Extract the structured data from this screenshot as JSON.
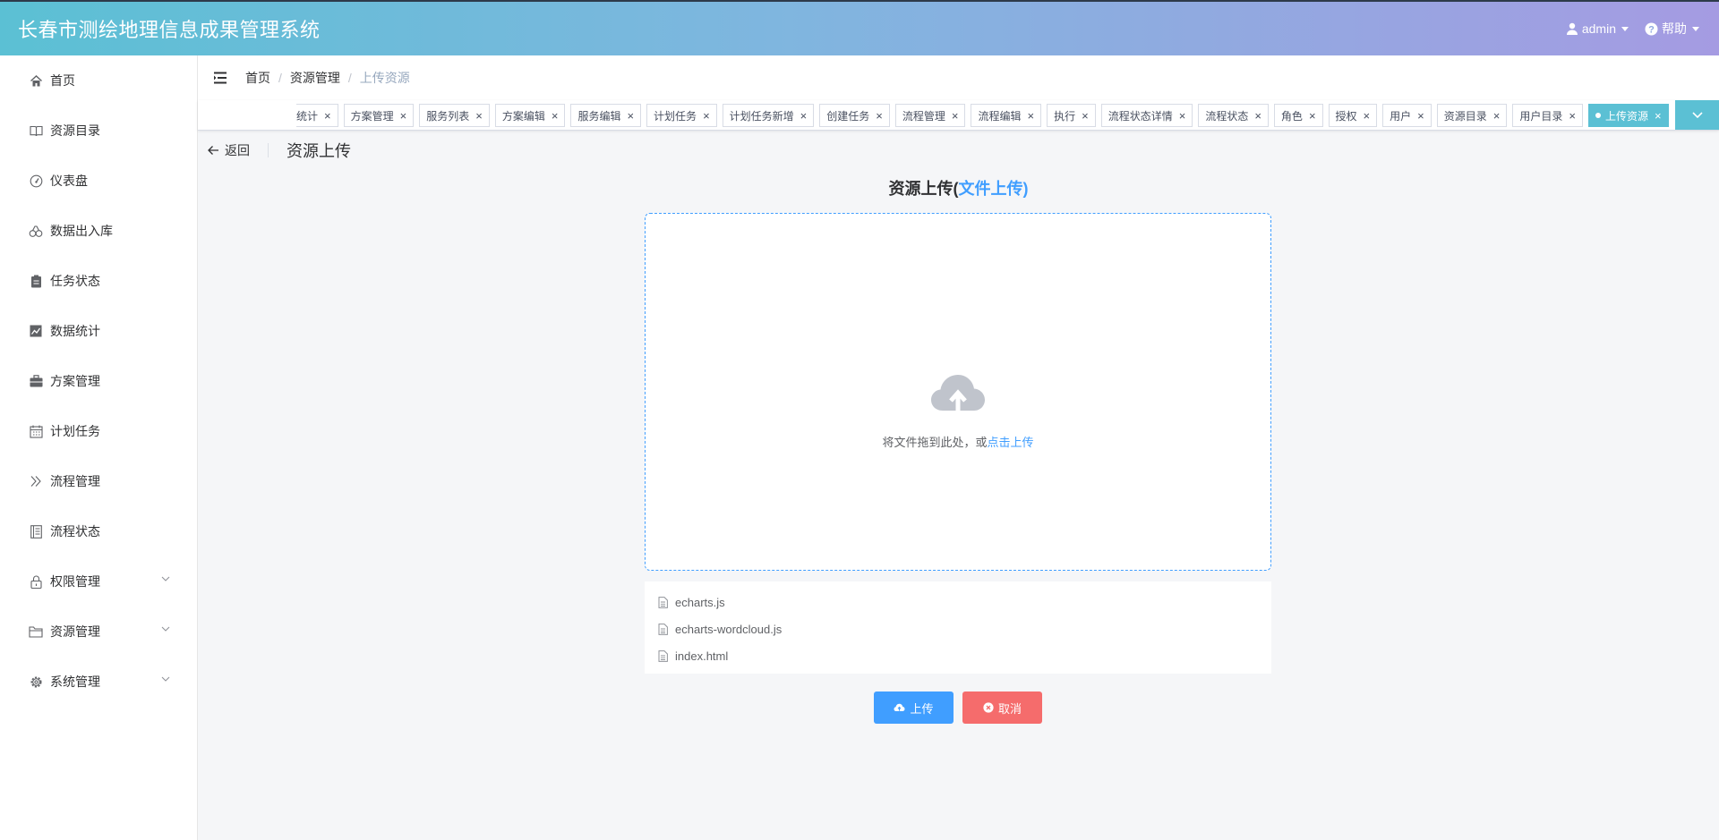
{
  "app": {
    "title": "长春市测绘地理信息成果管理系统"
  },
  "header": {
    "user": "admin",
    "help": "帮助"
  },
  "sidebar": {
    "items": [
      {
        "label": "首页",
        "icon": "home-icon"
      },
      {
        "label": "资源目录",
        "icon": "book-icon"
      },
      {
        "label": "仪表盘",
        "icon": "dashboard-icon"
      },
      {
        "label": "数据出入库",
        "icon": "link-icon"
      },
      {
        "label": "任务状态",
        "icon": "clipboard-icon"
      },
      {
        "label": "数据统计",
        "icon": "chart-icon"
      },
      {
        "label": "方案管理",
        "icon": "briefcase-icon"
      },
      {
        "label": "计划任务",
        "icon": "calendar-icon"
      },
      {
        "label": "流程管理",
        "icon": "double-chevron-icon"
      },
      {
        "label": "流程状态",
        "icon": "document-icon"
      },
      {
        "label": "权限管理",
        "icon": "lock-icon"
      },
      {
        "label": "资源管理",
        "icon": "folder-icon"
      },
      {
        "label": "系统管理",
        "icon": "gear-icon"
      }
    ]
  },
  "breadcrumb": {
    "items": [
      "首页",
      "资源管理",
      "上传资源"
    ]
  },
  "tags": [
    "统计",
    "方案管理",
    "服务列表",
    "方案编辑",
    "服务编辑",
    "计划任务",
    "计划任务新增",
    "创建任务",
    "流程管理",
    "流程编辑",
    "执行",
    "流程状态详情",
    "流程状态",
    "角色",
    "授权",
    "用户",
    "资源目录",
    "用户目录",
    "上传资源"
  ],
  "page": {
    "back": "返回",
    "title": "资源上传"
  },
  "upload": {
    "title_main": "资源上传(",
    "title_accent": "文件上传)",
    "drop_text": "将文件拖到此处，或",
    "drop_link": "点击上传"
  },
  "files": [
    "echarts.js",
    "echarts-wordcloud.js",
    "index.html"
  ],
  "buttons": {
    "upload": "上传",
    "cancel": "取消"
  },
  "colors": {
    "accent": "#409eff",
    "danger": "#f56c6c",
    "tag_active": "#5bc0d4"
  }
}
